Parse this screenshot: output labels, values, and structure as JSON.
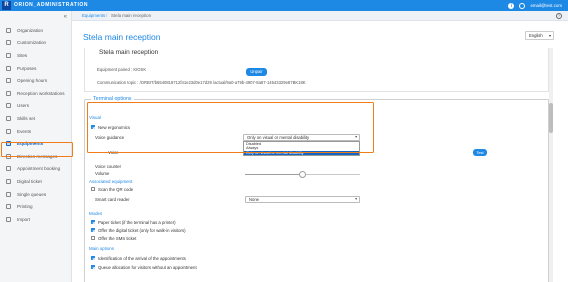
{
  "topbar": {
    "logo_letter": "R",
    "brand": "ORION_ADMINISTRATION",
    "user_email": "email@test.com",
    "info_icon": "info-icon",
    "user_icon": "user-icon"
  },
  "sidebar": {
    "collapse_glyph": "«",
    "items": [
      {
        "label": "Organization",
        "icon": "organization-icon",
        "active": false
      },
      {
        "label": "Customization",
        "icon": "palette-icon",
        "active": false
      },
      {
        "label": "Sites",
        "icon": "location-icon",
        "active": false
      },
      {
        "label": "Purposes",
        "icon": "list-icon",
        "active": false
      },
      {
        "label": "Opening hours",
        "icon": "clock-icon",
        "active": false
      },
      {
        "label": "Reception workstations",
        "icon": "desk-icon",
        "active": false
      },
      {
        "label": "Users",
        "icon": "users-icon",
        "active": false
      },
      {
        "label": "Skills set",
        "icon": "skills-icon",
        "active": false
      },
      {
        "label": "Events",
        "icon": "bell-icon",
        "active": false
      },
      {
        "label": "Equipments",
        "icon": "equipment-icon",
        "active": true
      },
      {
        "label": "Direction messages",
        "icon": "message-icon",
        "active": false
      },
      {
        "label": "Appointment booking",
        "icon": "calendar-icon",
        "active": false
      },
      {
        "label": "Digital ticket",
        "icon": "ticket-icon",
        "active": false
      },
      {
        "label": "Single queues",
        "icon": "queue-icon",
        "active": false
      },
      {
        "label": "Printing",
        "icon": "printer-icon",
        "active": false
      },
      {
        "label": "Import",
        "icon": "import-icon",
        "active": false
      }
    ]
  },
  "breadcrumb": {
    "first": "Equipments",
    "separator": "/",
    "current": "Stela main reception"
  },
  "page": {
    "title": "Stela main reception",
    "language": "English"
  },
  "pairing": {
    "title": "Stela main reception",
    "equipment_paired": "Equipment paired : KIOSK",
    "unpair_label": "Unpair",
    "communication_topic": "Communication topic : /ORBIT/b6540818712f41e23d0e17d29 /actual/9a0-a79b-4907-8a87-14543329e87BK18K"
  },
  "terminal_options": {
    "legend": "Terminal options",
    "visual_section": "Visual",
    "new_ergonomics_label": "New ergonomics",
    "new_ergonomics_checked": true,
    "voice_guidance_label": "Voice guidance",
    "voice_guidance_value": "Only on visual or mental disability",
    "voice_guidance_options": [
      "Disabled",
      "Always",
      "Only on visual or mental disability"
    ],
    "voice_guidance_selected_index": 2,
    "voice_label": "Voice",
    "test_label": "Test",
    "voice_counter_label": "Voice counter",
    "volume_label": "Volume",
    "volume_level": 0.5,
    "associated_equipment_section": "Associated equipment",
    "scan_qr_label": "Scan the QR code",
    "scan_qr_checked": false,
    "smart_card_label": "Smart card reader",
    "smart_card_value": "None",
    "modes_section": "Modes",
    "paper_ticket_label": "Paper ticket (if the terminal has a printer)",
    "paper_ticket_checked": true,
    "digital_ticket_label": "Offer the digital ticket (only for walk-in visitors)",
    "digital_ticket_checked": true,
    "sms_ticket_label": "Offer the SMS ticket",
    "sms_ticket_checked": false,
    "main_options_section": "Main options",
    "identification_label": "Identification of the arrival of the appointments",
    "identification_checked": true,
    "queue_allocation_label": "Queue allocation for visitors without an appointment",
    "queue_allocation_checked": true
  },
  "colors": {
    "accent": "#1e88e5",
    "highlight": "#f07c1a",
    "dropdown_selected": "#1565c0"
  }
}
